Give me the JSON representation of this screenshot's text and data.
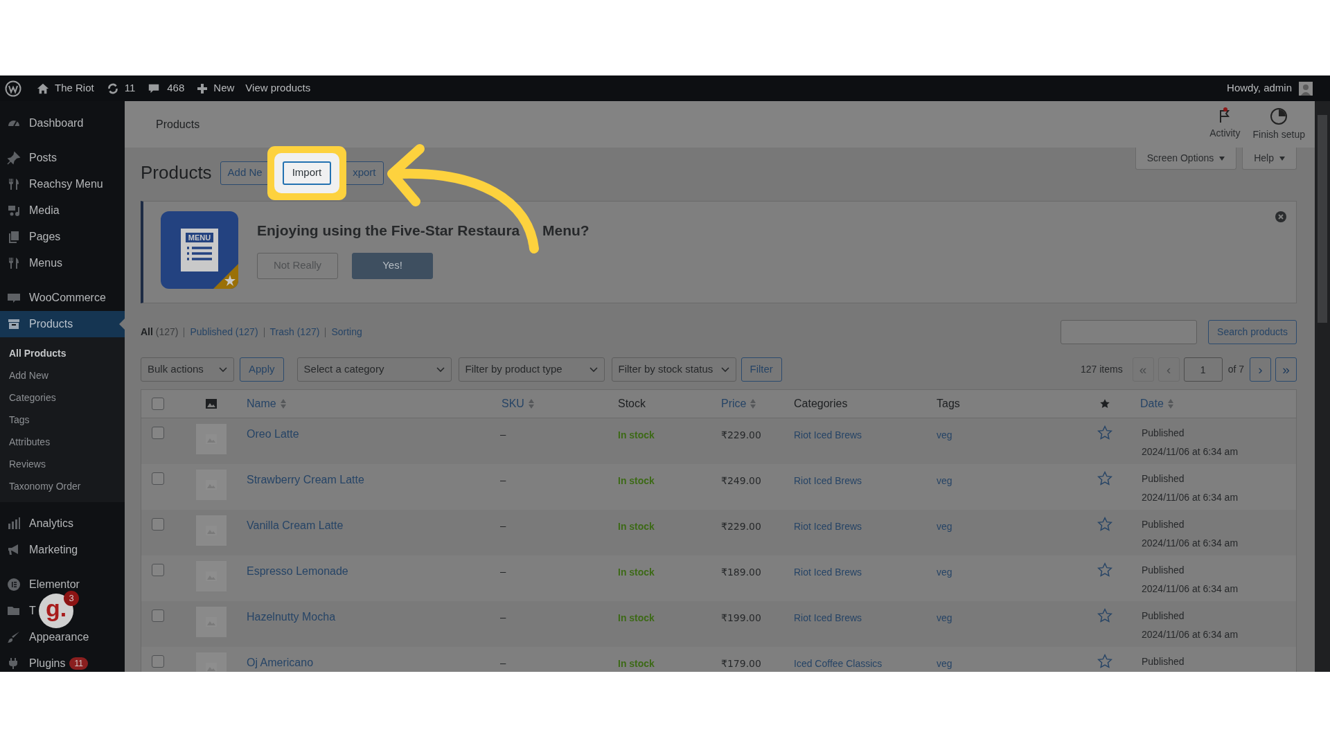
{
  "admin_bar": {
    "site": "The Riot",
    "updates": "11",
    "comments": "468",
    "new": "New",
    "view": "View products",
    "greeting": "Howdy, admin"
  },
  "sidebar": {
    "groups": [
      [
        {
          "label": "Dashboard",
          "selected": false
        }
      ],
      [
        {
          "label": "Posts",
          "selected": false
        },
        {
          "label": "Reachsy Menu",
          "selected": false
        },
        {
          "label": "Media",
          "selected": false
        },
        {
          "label": "Pages",
          "selected": false
        },
        {
          "label": "Menus",
          "selected": false
        }
      ],
      [
        {
          "label": "WooCommerce",
          "selected": false
        },
        {
          "label": "Products",
          "selected": true,
          "children": [
            {
              "label": "All Products",
              "selected": true
            },
            {
              "label": "Add New",
              "selected": false
            },
            {
              "label": "Categories",
              "selected": false
            },
            {
              "label": "Tags",
              "selected": false
            },
            {
              "label": "Attributes",
              "selected": false
            },
            {
              "label": "Reviews",
              "selected": false
            },
            {
              "label": "Taxonomy Order",
              "selected": false
            }
          ]
        }
      ],
      [
        {
          "label": "Analytics",
          "selected": false
        },
        {
          "label": "Marketing",
          "selected": false
        }
      ],
      [
        {
          "label": "Elementor",
          "selected": false
        },
        {
          "label": "T",
          "selected": false
        },
        {
          "label": "Appearance",
          "selected": false
        },
        {
          "label": "Plugins",
          "selected": false,
          "badge": "11"
        }
      ]
    ]
  },
  "floating_widget": {
    "logo": "g.",
    "badge": "3"
  },
  "header": {
    "title": "Products",
    "actions": [
      {
        "label": "Activity",
        "alert": true
      },
      {
        "label": "Finish setup",
        "alert": false
      }
    ]
  },
  "screen_tabs": [
    "Screen Options",
    "Help"
  ],
  "page": {
    "title": "Products",
    "actions": [
      {
        "label": "Add Ne",
        "highlighted": false
      },
      {
        "label": "Import",
        "highlighted": true
      },
      {
        "label": "xport",
        "highlighted": false
      }
    ]
  },
  "notice": {
    "logo_label": "MENU",
    "heading_parts": [
      "Enjoying using the Five-Star Restaura",
      "Menu?"
    ],
    "buttons": [
      {
        "label": "Not Really",
        "kind": "secondary"
      },
      {
        "label": "Yes!",
        "kind": "primary"
      }
    ]
  },
  "views": [
    {
      "label": "All",
      "count": "(127)",
      "selected": true
    },
    {
      "label": "Published",
      "count": "(127)",
      "selected": false
    },
    {
      "label": "Trash",
      "count": "(127)",
      "selected": false
    },
    {
      "label": "Sorting",
      "selected": false
    }
  ],
  "search": {
    "button": "Search products"
  },
  "filters": {
    "bulk": "Bulk actions",
    "apply": "Apply",
    "selects": [
      "Select a category",
      "Filter by product type",
      "Filter by stock status"
    ],
    "filter": "Filter"
  },
  "pagination": {
    "count": "127 items",
    "first": {
      "label": "«",
      "disabled": true
    },
    "prev": {
      "label": "‹",
      "disabled": true
    },
    "page": "1",
    "total": "of 7",
    "next": {
      "label": "›",
      "disabled": false
    },
    "last": {
      "label": "»",
      "disabled": false
    }
  },
  "table": {
    "columns": [
      {
        "kind": "check",
        "checked": false
      },
      {
        "kind": "image"
      },
      {
        "kind": "text",
        "label": "Name",
        "sortable": true
      },
      {
        "kind": "text",
        "label": "SKU",
        "sortable": true
      },
      {
        "kind": "text",
        "label": "Stock",
        "sortable": false
      },
      {
        "kind": "text",
        "label": "Price",
        "sortable": true
      },
      {
        "kind": "text",
        "label": "Categories",
        "sortable": false
      },
      {
        "kind": "text",
        "label": "Tags",
        "sortable": false
      },
      {
        "kind": "featured"
      },
      {
        "kind": "text",
        "label": "Date",
        "sortable": true
      }
    ],
    "rows": [
      {
        "checked": false,
        "name": "Oreo Latte",
        "sku": "–",
        "stock": "In stock",
        "price": "₹229.00",
        "category": "Riot Iced Brews",
        "tag": "veg",
        "featured": false,
        "status": "Published",
        "date": "2024/11/06 at 6:34 am"
      },
      {
        "checked": false,
        "name": "Strawberry Cream Latte",
        "sku": "–",
        "stock": "In stock",
        "price": "₹249.00",
        "category": "Riot Iced Brews",
        "tag": "veg",
        "featured": false,
        "status": "Published",
        "date": "2024/11/06 at 6:34 am"
      },
      {
        "checked": false,
        "name": "Vanilla Cream Latte",
        "sku": "–",
        "stock": "In stock",
        "price": "₹229.00",
        "category": "Riot Iced Brews",
        "tag": "veg",
        "featured": false,
        "status": "Published",
        "date": "2024/11/06 at 6:34 am"
      },
      {
        "checked": false,
        "name": "Espresso Lemonade",
        "sku": "–",
        "stock": "In stock",
        "price": "₹189.00",
        "category": "Riot Iced Brews",
        "tag": "veg",
        "featured": false,
        "status": "Published",
        "date": "2024/11/06 at 6:34 am"
      },
      {
        "checked": false,
        "name": "Hazelnutty Mocha",
        "sku": "–",
        "stock": "In stock",
        "price": "₹199.00",
        "category": "Riot Iced Brews",
        "tag": "veg",
        "featured": false,
        "status": "Published",
        "date": "2024/11/06 at 6:34 am"
      },
      {
        "checked": false,
        "name": "Oj Americano",
        "sku": "–",
        "stock": "In stock",
        "price": "₹179.00",
        "category": "Iced Coffee Classics",
        "tag": "veg",
        "featured": false,
        "status": "Published"
      }
    ]
  }
}
